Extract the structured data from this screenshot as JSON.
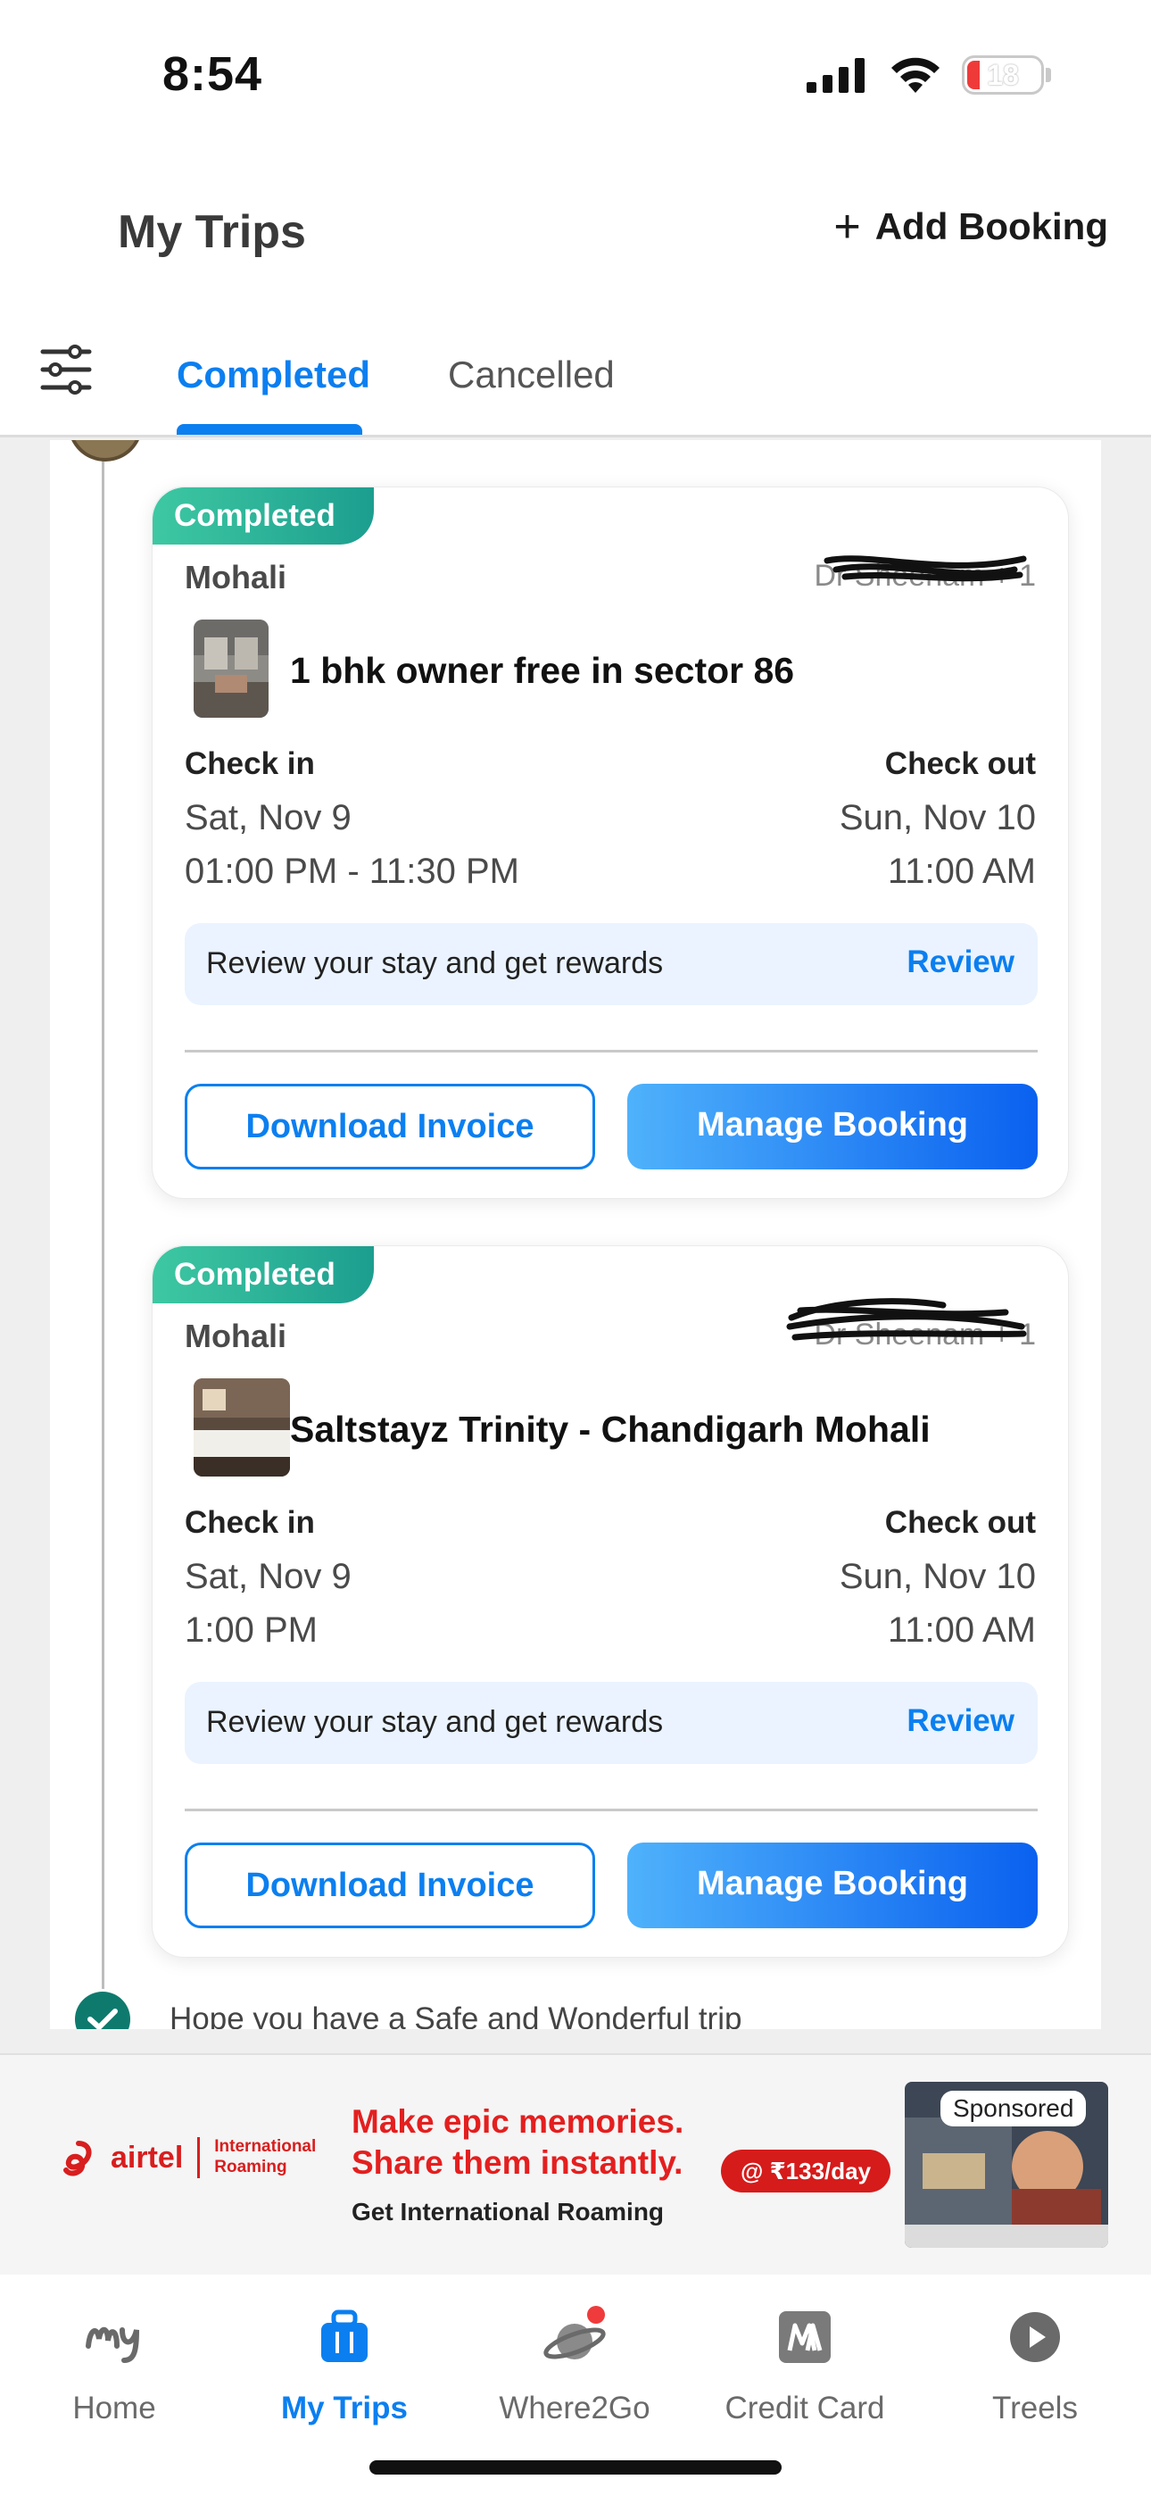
{
  "status_bar": {
    "time": "8:54",
    "battery": "18"
  },
  "header": {
    "title": "My Trips",
    "add_booking": "Add Booking",
    "add_icon": "plus-icon"
  },
  "tabs": {
    "completed": "Completed",
    "cancelled": "Cancelled",
    "filter_icon": "filter-sliders-icon"
  },
  "bookings": [
    {
      "status": "Completed",
      "city": "Mohali",
      "guest": "Dr Sheenam + 1",
      "hotel": "1 bhk owner free in sector 86",
      "checkin_label": "Check in",
      "checkout_label": "Check out",
      "checkin_date": "Sat, Nov 9",
      "checkin_time": "01:00 PM - 11:30 PM",
      "checkout_date": "Sun, Nov 10",
      "checkout_time": "11:00 AM",
      "review_text": "Review your stay and get rewards",
      "review_link": "Review",
      "download_invoice": "Download Invoice",
      "manage_booking": "Manage Booking"
    },
    {
      "status": "Completed",
      "city": "Mohali",
      "guest": "Dr Sheenam + 1",
      "hotel": "Saltstayz Trinity - Chandigarh Mohali",
      "checkin_label": "Check in",
      "checkout_label": "Check out",
      "checkin_date": "Sat, Nov 9",
      "checkin_time": "1:00 PM",
      "checkout_date": "Sun, Nov 10",
      "checkout_time": "11:00 AM",
      "review_text": "Review your stay and get rewards",
      "review_link": "Review",
      "download_invoice": "Download Invoice",
      "manage_booking": "Manage Booking"
    }
  ],
  "timeline_footer": "Hope you have a Safe and Wonderful trip",
  "ad": {
    "brand": "airtel",
    "brand_sub": "International Roaming",
    "headline_1": "Make epic memories.",
    "headline_2": "Share them instantly.",
    "subline": "Get International Roaming",
    "price": "@ ₹133/day",
    "sponsored": "Sponsored"
  },
  "bottom_nav": [
    {
      "label": "Home",
      "icon": "mmt-logo-icon",
      "active": false
    },
    {
      "label": "My Trips",
      "icon": "suitcase-icon",
      "active": true
    },
    {
      "label": "Where2Go",
      "icon": "planet-icon",
      "active": false
    },
    {
      "label": "Credit Card",
      "icon": "card-logo-icon",
      "active": false
    },
    {
      "label": "Treels",
      "icon": "play-icon",
      "active": false
    }
  ],
  "colors": {
    "accent": "#0b7ff0",
    "badge": "#1c9e8f",
    "ad_red": "#e41f1f"
  }
}
